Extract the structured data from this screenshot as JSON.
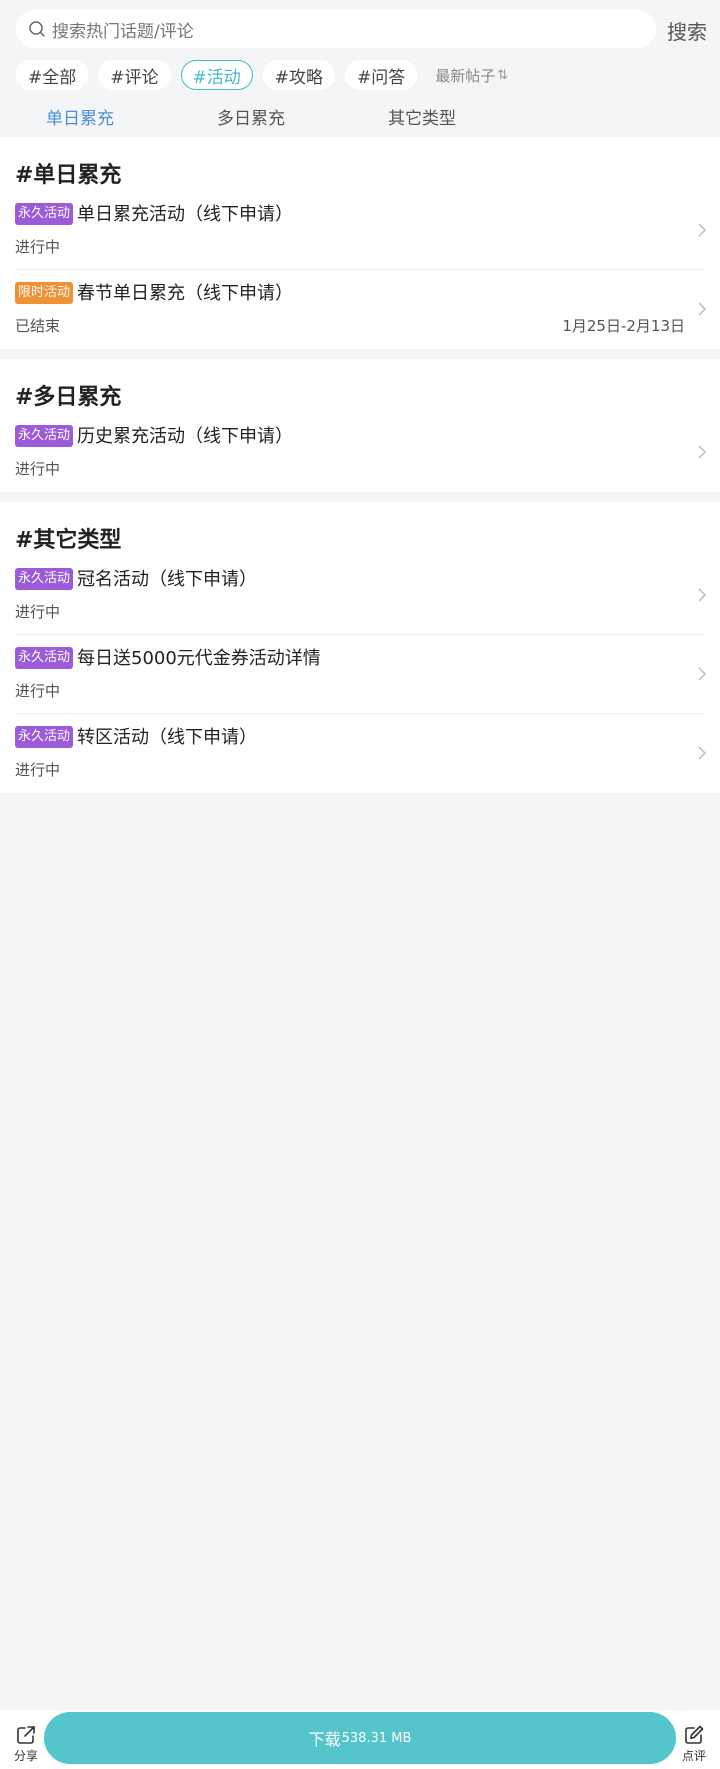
{
  "search": {
    "placeholder": "搜索热门话题/评论",
    "button": "搜索"
  },
  "chips": [
    "#全部",
    "#评论",
    "#活动",
    "#攻略",
    "#问答"
  ],
  "chips_active_index": 2,
  "sort_label": "最新帖子",
  "subtabs": {
    "items": [
      "单日累充",
      "多日累充",
      "其它类型"
    ],
    "active_index": 0
  },
  "sections": [
    {
      "title": "#单日累充",
      "rows": [
        {
          "tag": "永久活动",
          "tag_type": "perm",
          "title": "单日累充活动（线下申请）",
          "status": "进行中",
          "date": ""
        },
        {
          "tag": "限时活动",
          "tag_type": "limited",
          "title": "春节单日累充（线下申请）",
          "status": "已结束",
          "date": "1月25日-2月13日"
        }
      ]
    },
    {
      "title": "#多日累充",
      "rows": [
        {
          "tag": "永久活动",
          "tag_type": "perm",
          "title": "历史累充活动（线下申请）",
          "status": "进行中",
          "date": ""
        }
      ]
    },
    {
      "title": "#其它类型",
      "rows": [
        {
          "tag": "永久活动",
          "tag_type": "perm",
          "title": "冠名活动（线下申请）",
          "status": "进行中",
          "date": ""
        },
        {
          "tag": "永久活动",
          "tag_type": "perm",
          "title": "每日送5000元代金券活动详情",
          "status": "进行中",
          "date": ""
        },
        {
          "tag": "永久活动",
          "tag_type": "perm",
          "title": "转区活动（线下申请）",
          "status": "进行中",
          "date": ""
        }
      ]
    }
  ],
  "bottom": {
    "share_label": "分享",
    "download_label": "下载",
    "download_size": "538.31 MB",
    "review_label": "点评"
  },
  "colors": {
    "accent": "#55c5cc",
    "chip_active": "#45b9c6",
    "tab_active": "#4a90d9",
    "tag_permanent": "#9c5bd8",
    "tag_limited": "#ee9234",
    "background": "#f4f5f7"
  },
  "icons": {
    "search": "search-icon",
    "sort": "sort-icon",
    "chevron": "chevron-right-icon",
    "share": "share-icon",
    "review": "edit-icon"
  }
}
